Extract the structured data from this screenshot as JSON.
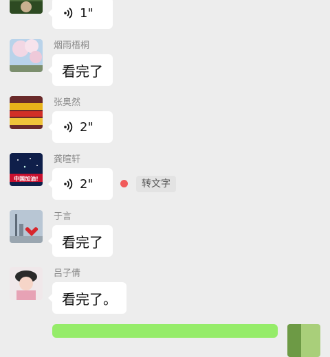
{
  "messages": [
    {
      "sender": "",
      "type": "voice",
      "duration": "1\"",
      "avatar": "landscape-avatar"
    },
    {
      "sender": "烟雨梧桐",
      "type": "text",
      "text": "看完了",
      "avatar": "cherry-blossom-avatar"
    },
    {
      "sender": "张奥然",
      "type": "voice",
      "duration": "2\"",
      "avatar": "colorful-avatar"
    },
    {
      "sender": "龚暄轩",
      "type": "voice",
      "duration": "2\"",
      "avatar": "china-flag-avatar",
      "avatar_text": "中国加油!",
      "unread": true,
      "transcribe_label": "转文字"
    },
    {
      "sender": "于言",
      "type": "text",
      "text": "看完了",
      "avatar": "cityscape-avatar"
    },
    {
      "sender": "吕子倩",
      "type": "text",
      "text": "看完了。",
      "avatar": "girl-avatar"
    }
  ],
  "colors": {
    "background": "#ededed",
    "bubble": "#ffffff",
    "self_bubble": "#95ec69",
    "unread_dot": "#f15b5b"
  }
}
